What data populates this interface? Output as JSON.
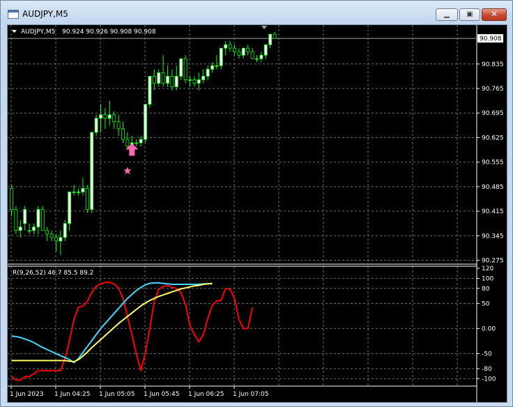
{
  "window": {
    "title": "AUDJPY,M5",
    "controls": [
      "minimize",
      "maximize",
      "close"
    ]
  },
  "colors": {
    "background": "#000000",
    "grid": "#6e6e6e",
    "axis_text": "#ffffff",
    "bull_candle": "#ffffff",
    "bull_outline": "#00ff00",
    "bear_candle": "#000000",
    "wick": "#00ff00",
    "price_line": "#a0a0a0",
    "arrow": "#ff69b4",
    "line_red": "#ff0000",
    "line_cyan": "#46d8ff",
    "line_yellow": "#ffff66"
  },
  "chart_data": [
    {
      "type": "candlestick",
      "title": "AUDJPY,M5",
      "header_values": "90.924 90.926 90.908 90.908",
      "last_price": "90.908",
      "y_ticks": [
        "90.835",
        "90.765",
        "90.695",
        "90.625",
        "90.555",
        "90.485",
        "90.415",
        "90.345",
        "90.275"
      ],
      "ylim": [
        90.27,
        90.93
      ],
      "x_ticks": [
        "1 Jun 2023",
        "1 Jun 04:25",
        "1 Jun 05:05",
        "1 Jun 05:45",
        "1 Jun 06:25",
        "1 Jun 07:05"
      ],
      "grid": true,
      "ohlc": [
        [
          90.48,
          90.49,
          90.4,
          90.42
        ],
        [
          90.42,
          90.43,
          90.35,
          90.36
        ],
        [
          90.36,
          90.39,
          90.34,
          90.37
        ],
        [
          90.38,
          90.43,
          90.36,
          90.42
        ],
        [
          90.36,
          90.38,
          90.35,
          90.36
        ],
        [
          90.36,
          90.38,
          90.35,
          90.37
        ],
        [
          90.37,
          90.43,
          90.35,
          90.42
        ],
        [
          90.42,
          90.43,
          90.36,
          90.36
        ],
        [
          90.36,
          90.37,
          90.33,
          90.35
        ],
        [
          90.35,
          90.36,
          90.33,
          90.34
        ],
        [
          90.34,
          90.35,
          90.3,
          90.33
        ],
        [
          90.33,
          90.36,
          90.29,
          90.34
        ],
        [
          90.34,
          90.39,
          90.33,
          90.38
        ],
        [
          90.38,
          90.47,
          90.36,
          90.47
        ],
        [
          90.47,
          90.49,
          90.46,
          90.47
        ],
        [
          90.47,
          90.48,
          90.46,
          90.47
        ],
        [
          90.47,
          90.51,
          90.46,
          90.48
        ],
        [
          90.48,
          90.49,
          90.41,
          90.42
        ],
        [
          90.42,
          90.64,
          90.41,
          90.64
        ],
        [
          90.64,
          90.69,
          90.63,
          90.68
        ],
        [
          90.68,
          90.72,
          90.64,
          90.69
        ],
        [
          90.69,
          90.71,
          90.65,
          90.68
        ],
        [
          90.68,
          90.73,
          90.66,
          90.69
        ],
        [
          90.69,
          90.7,
          90.65,
          90.67
        ],
        [
          90.67,
          90.69,
          90.63,
          90.65
        ],
        [
          90.65,
          90.67,
          90.61,
          90.62
        ],
        [
          90.62,
          90.64,
          90.59,
          90.6
        ],
        [
          90.6,
          90.63,
          90.59,
          90.61
        ],
        [
          90.61,
          90.62,
          90.6,
          90.61
        ],
        [
          90.61,
          90.63,
          90.6,
          90.62
        ],
        [
          90.62,
          90.72,
          90.61,
          90.72
        ],
        [
          90.72,
          90.8,
          90.71,
          90.8
        ],
        [
          90.8,
          90.82,
          90.76,
          90.78
        ],
        [
          90.78,
          90.82,
          90.77,
          90.81
        ],
        [
          90.81,
          90.86,
          90.77,
          90.78
        ],
        [
          90.78,
          90.83,
          90.77,
          90.8
        ],
        [
          90.8,
          90.82,
          90.76,
          90.77
        ],
        [
          90.77,
          90.83,
          90.76,
          90.8
        ],
        [
          90.8,
          90.85,
          90.79,
          90.85
        ],
        [
          90.85,
          90.86,
          90.78,
          90.79
        ],
        [
          90.79,
          90.8,
          90.77,
          90.79
        ],
        [
          90.79,
          90.8,
          90.77,
          90.78
        ],
        [
          90.78,
          90.81,
          90.76,
          90.79
        ],
        [
          90.79,
          90.82,
          90.78,
          90.8
        ],
        [
          90.8,
          90.83,
          90.79,
          90.82
        ],
        [
          90.82,
          90.84,
          90.81,
          90.83
        ],
        [
          90.83,
          90.86,
          90.82,
          90.83
        ],
        [
          90.83,
          90.88,
          90.82,
          90.88
        ],
        [
          90.88,
          90.9,
          90.86,
          90.89
        ],
        [
          90.89,
          90.9,
          90.87,
          90.88
        ],
        [
          90.88,
          90.89,
          90.86,
          90.87
        ],
        [
          90.87,
          90.88,
          90.85,
          90.86
        ],
        [
          90.86,
          90.88,
          90.85,
          90.88
        ],
        [
          90.88,
          90.89,
          90.86,
          90.87
        ],
        [
          90.87,
          90.88,
          90.85,
          90.85
        ],
        [
          90.85,
          90.86,
          90.84,
          90.85
        ],
        [
          90.85,
          90.87,
          90.84,
          90.86
        ],
        [
          90.86,
          90.89,
          90.85,
          90.89
        ],
        [
          90.89,
          90.92,
          90.88,
          90.92
        ],
        [
          90.92,
          90.926,
          90.908,
          90.908
        ]
      ],
      "signals": [
        {
          "type": "buy-arrow",
          "index": 27,
          "price": 90.595
        },
        {
          "type": "star",
          "index": 26,
          "price": 90.53
        }
      ]
    },
    {
      "type": "line",
      "title": "R(9,26,52) 46.7 85.5 89.2",
      "y_ticks": [
        "120",
        "100",
        "80",
        "50",
        "0.00",
        "-50",
        "-80",
        "-100"
      ],
      "ylim": [
        -112,
        120
      ],
      "grid": true,
      "series": [
        {
          "color": "#ff0000",
          "values": [
            -96,
            -103,
            -103,
            -96,
            -96,
            -90,
            -84,
            -84,
            -84,
            -84,
            -84,
            -84,
            -60,
            -24,
            18,
            42,
            45,
            54,
            72,
            84,
            89,
            92,
            92,
            89,
            81,
            60,
            24,
            -12,
            -51,
            -84,
            -48,
            0,
            54,
            78,
            84,
            86,
            82,
            80,
            72,
            48,
            6,
            -12,
            -27,
            -12,
            20,
            46,
            55,
            56,
            80,
            78,
            60,
            18,
            0,
            0,
            42
          ]
        },
        {
          "color": "#46d8ff",
          "values": [
            -15,
            -16,
            -18,
            -21,
            -24,
            -28,
            -33,
            -38,
            -42,
            -46,
            -50,
            -54,
            -58,
            -62,
            -68,
            -60,
            -48,
            -36,
            -24,
            -12,
            0,
            10,
            20,
            30,
            40,
            50,
            60,
            68,
            76,
            82,
            87,
            90,
            91,
            91,
            90,
            89,
            88,
            88,
            88,
            88,
            88,
            88,
            88,
            89,
            89,
            89
          ]
        },
        {
          "color": "#ffff66",
          "values": [
            -64,
            -64,
            -64,
            -64,
            -64,
            -64,
            -64,
            -64,
            -64,
            -64,
            -64,
            -64,
            -64,
            -65,
            -66,
            -62,
            -55,
            -47,
            -38,
            -30,
            -22,
            -14,
            -6,
            2,
            10,
            17,
            24,
            31,
            38,
            45,
            51,
            56,
            60,
            64,
            67,
            70,
            73,
            76,
            79,
            81,
            83,
            85,
            86,
            88,
            89,
            90
          ]
        }
      ]
    }
  ]
}
